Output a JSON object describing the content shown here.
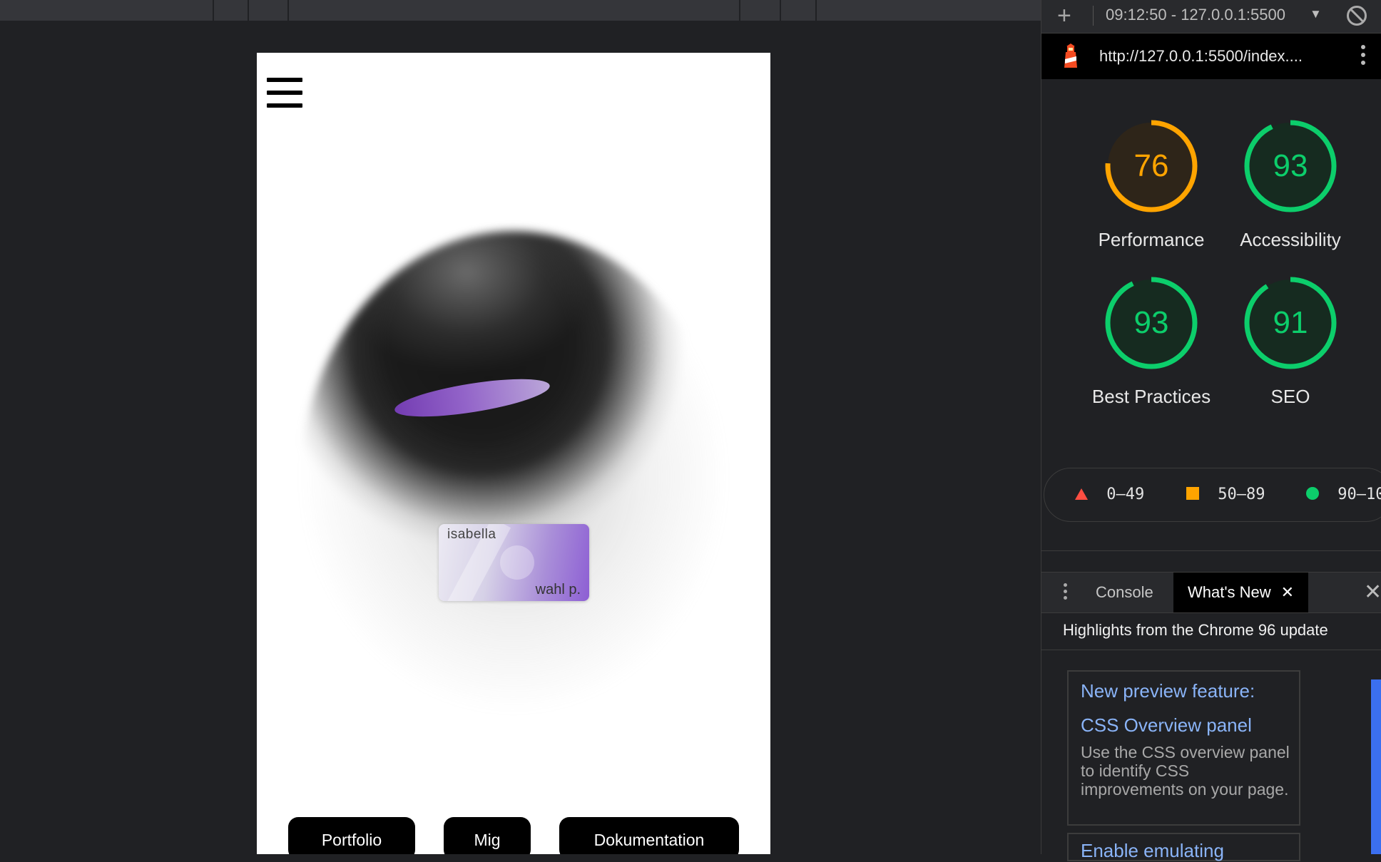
{
  "viewport_page": {
    "card": {
      "line1": "isabella",
      "line2": "wahl p."
    },
    "nav": [
      "Portfolio",
      "Mig",
      "Dokumentation"
    ]
  },
  "devtools": {
    "report_label": "09:12:50 - 127.0.0.1:5500",
    "url": "http://127.0.0.1:5500/index....",
    "scores": [
      {
        "label": "Performance",
        "value": "76",
        "color": "#ffa400"
      },
      {
        "label": "Accessibility",
        "value": "93",
        "color": "#0cce6b"
      },
      {
        "label": "Best Practices",
        "value": "93",
        "color": "#0cce6b"
      },
      {
        "label": "SEO",
        "value": "91",
        "color": "#0cce6b"
      }
    ],
    "legend": [
      {
        "range": "0–49",
        "color": "#ff4e42",
        "shape": "triangle"
      },
      {
        "range": "50–89",
        "color": "#ffa400",
        "shape": "square"
      },
      {
        "range": "90–10",
        "color": "#0cce6b",
        "shape": "circle"
      }
    ],
    "drawer_tabs": {
      "console": "Console",
      "whats_new": "What's New"
    },
    "highlights": "Highlights from the Chrome 96 update",
    "feature": {
      "title": "New preview feature:",
      "subtitle": "CSS Overview panel",
      "description": "Use the CSS overview panel to identify CSS improvements on your page."
    },
    "feature2_title": "Enable emulating"
  }
}
